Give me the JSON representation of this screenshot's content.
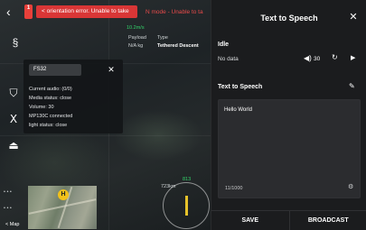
{
  "topbar": {
    "alert_count": "1",
    "alert_text": "< orientation error. Unable to take",
    "mode_text": "N mode - Unable to ta"
  },
  "telemetry": {
    "speed_top": "10.2m/s",
    "payload_label": "Payload",
    "payload_value": "N/A kg",
    "type_label": "Type",
    "type_value": "Tethered Descent",
    "distance": "723km",
    "heading_value": "813"
  },
  "popup": {
    "input_value": "FS32",
    "lines": [
      "Current audio: (0/0)",
      "Media status: close",
      "Volume: 30",
      "MP130C connected",
      "light status: close"
    ]
  },
  "map": {
    "tag": "< Map",
    "home_marker": "H"
  },
  "panel": {
    "title": "Text to Speech",
    "status_title": "Idle",
    "status_data": "No data",
    "volume": "30",
    "tts_label": "Text to Speech",
    "text_value": "Hello World",
    "char_count": "11/1000",
    "save_label": "SAVE",
    "broadcast_label": "BROADCAST"
  }
}
